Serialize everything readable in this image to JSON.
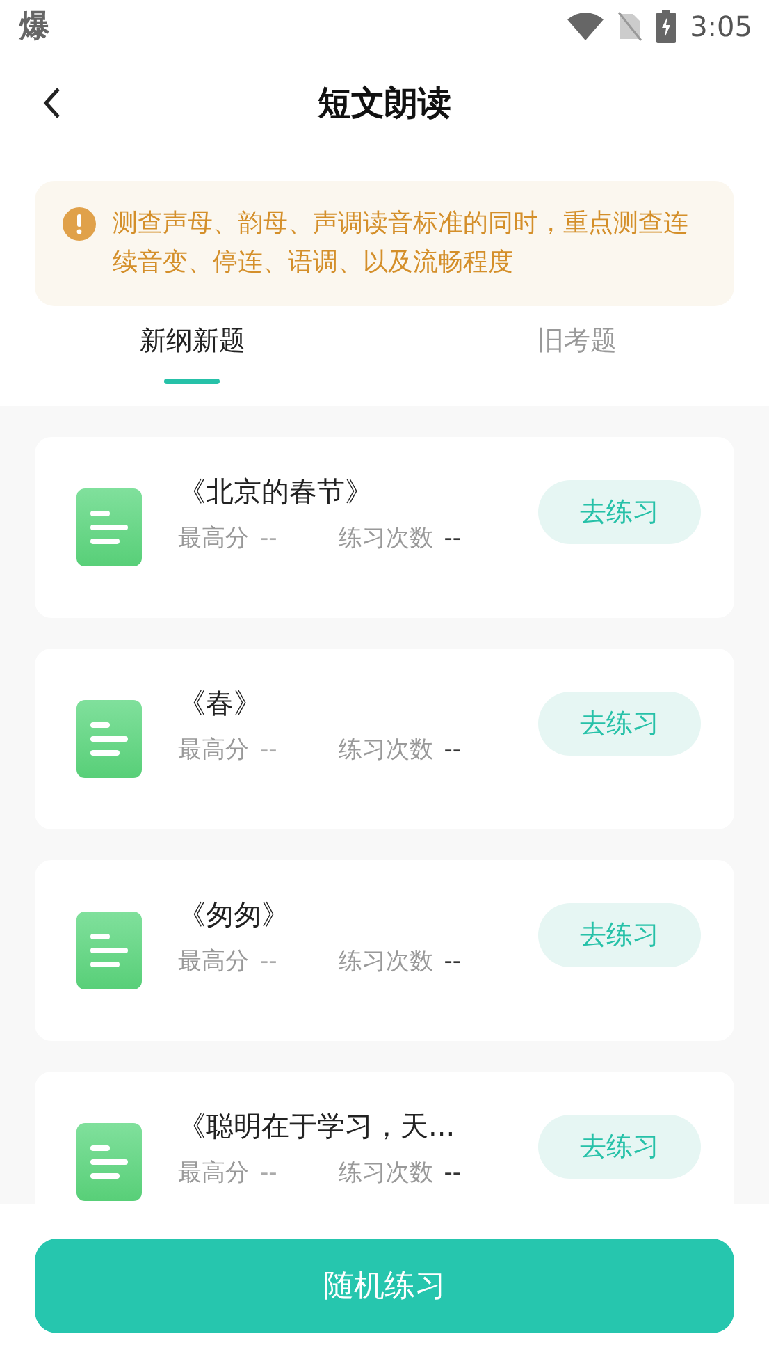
{
  "status_bar": {
    "notification": "爆",
    "time": "3:05"
  },
  "header": {
    "title": "短文朗读"
  },
  "notice": {
    "text": "测查声母、韵母、声调读音标准的同时，重点测查连续音变、停连、语调、以及流畅程度"
  },
  "tabs": [
    {
      "label": "新纲新题",
      "selected": true
    },
    {
      "label": "旧考题",
      "selected": false
    }
  ],
  "items": [
    {
      "title": "《北京的春节》",
      "best_label": "最高分",
      "best_value": "--",
      "count_label": "练习次数",
      "count_value": "--",
      "button": "去练习"
    },
    {
      "title": "《春》",
      "best_label": "最高分",
      "best_value": "--",
      "count_label": "练习次数",
      "count_value": "--",
      "button": "去练习"
    },
    {
      "title": "《匆匆》",
      "best_label": "最高分",
      "best_value": "--",
      "count_label": "练习次数",
      "count_value": "--",
      "button": "去练习"
    },
    {
      "title": "《聪明在于学习，天...",
      "best_label": "最高分",
      "best_value": "--",
      "count_label": "练习次数",
      "count_value": "--",
      "button": "去练习"
    }
  ],
  "bottom_button": "随机练习"
}
